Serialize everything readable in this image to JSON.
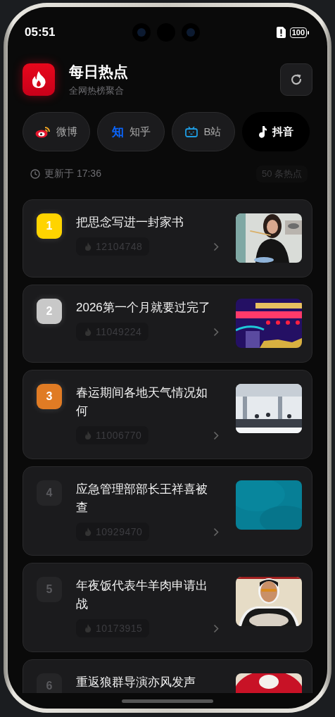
{
  "status_bar": {
    "time": "05:51",
    "battery": "100"
  },
  "header": {
    "title": "每日热点",
    "subtitle": "全网热榜聚合"
  },
  "tabs": [
    {
      "kind": "weibo",
      "label": "微博",
      "selected": false
    },
    {
      "kind": "zhihu",
      "logo": "知",
      "label": "知乎",
      "selected": false
    },
    {
      "kind": "bilibili",
      "label": "B站",
      "selected": false
    },
    {
      "kind": "douyin",
      "label": "抖音",
      "selected": true
    }
  ],
  "updated": "更新于 17:36",
  "count": "50 条热点",
  "items": [
    {
      "rank": "1",
      "color": "#ffd400",
      "title": "把思念写进一封家书",
      "heat": "12104748"
    },
    {
      "rank": "2",
      "color": "#c8c8c8",
      "title": "2026第一个月就要过完了",
      "heat": "11049224"
    },
    {
      "rank": "3",
      "color": "#e07b24",
      "title": "春运期间各地天气情况如何",
      "heat": "11006770"
    },
    {
      "rank": "4",
      "color": "#252527",
      "title": "应急管理部部长王祥喜被查",
      "heat": "10929470"
    },
    {
      "rank": "5",
      "color": "#252527",
      "title": "年夜饭代表牛羊肉申请出战",
      "heat": "10173915"
    },
    {
      "rank": "6",
      "color": "#252527",
      "title": "重返狼群导演亦风发声"
    }
  ]
}
